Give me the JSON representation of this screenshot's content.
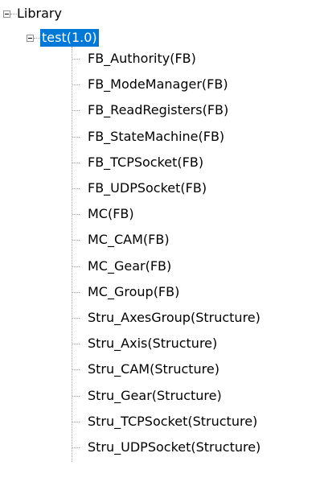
{
  "tree": {
    "root": {
      "label": "Library"
    },
    "child": {
      "label": "test(1.0)"
    },
    "items": [
      "FB_Authority(FB)",
      "FB_ModeManager(FB)",
      "FB_ReadRegisters(FB)",
      "FB_StateMachine(FB)",
      "FB_TCPSocket(FB)",
      "FB_UDPSocket(FB)",
      "MC(FB)",
      "MC_CAM(FB)",
      "MC_Gear(FB)",
      "MC_Group(FB)",
      "Stru_AxesGroup(Structure)",
      "Stru_Axis(Structure)",
      "Stru_CAM(Structure)",
      "Stru_Gear(Structure)",
      "Stru_TCPSocket(Structure)",
      "Stru_UDPSocket(Structure)"
    ]
  }
}
